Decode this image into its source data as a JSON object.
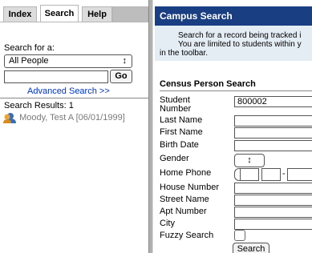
{
  "tabs": [
    {
      "label": "Index"
    },
    {
      "label": "Search"
    },
    {
      "label": "Help"
    }
  ],
  "search_for": {
    "label": "Search for a:",
    "selected": "All People",
    "select_arrows": "↕",
    "query_value": "",
    "go_label": "Go",
    "advanced_link": "Advanced Search >>"
  },
  "results": {
    "summary": "Search Results: 1",
    "items": [
      {
        "text": "Moody, Test A [06/01/1999]"
      }
    ]
  },
  "campus_search": {
    "title": "Campus Search",
    "info_line1": "Search for a record being tracked i",
    "info_line2": "You are limited to students within y",
    "info_line3": "in the toolbar."
  },
  "census_form": {
    "title": "Census Person Search",
    "fields": {
      "student_number_label_1": "Student",
      "student_number_label_2": "Number",
      "student_number_value": "800002",
      "last_name_label": "Last Name",
      "first_name_label": "First Name",
      "birth_date_label": "Birth Date",
      "gender_label": "Gender",
      "gender_arrows": "↕",
      "home_phone_label": "Home Phone",
      "house_number_label": "House Number",
      "street_name_label": "Street Name",
      "apt_number_label": "Apt Number",
      "city_label": "City",
      "fuzzy_search_label": "Fuzzy Search"
    },
    "search_button": "Search"
  },
  "colors": {
    "header_bg": "#1a3e82",
    "info_bg": "#e4ecf4",
    "link": "#0033cc",
    "result_text": "#7a7a7a"
  }
}
